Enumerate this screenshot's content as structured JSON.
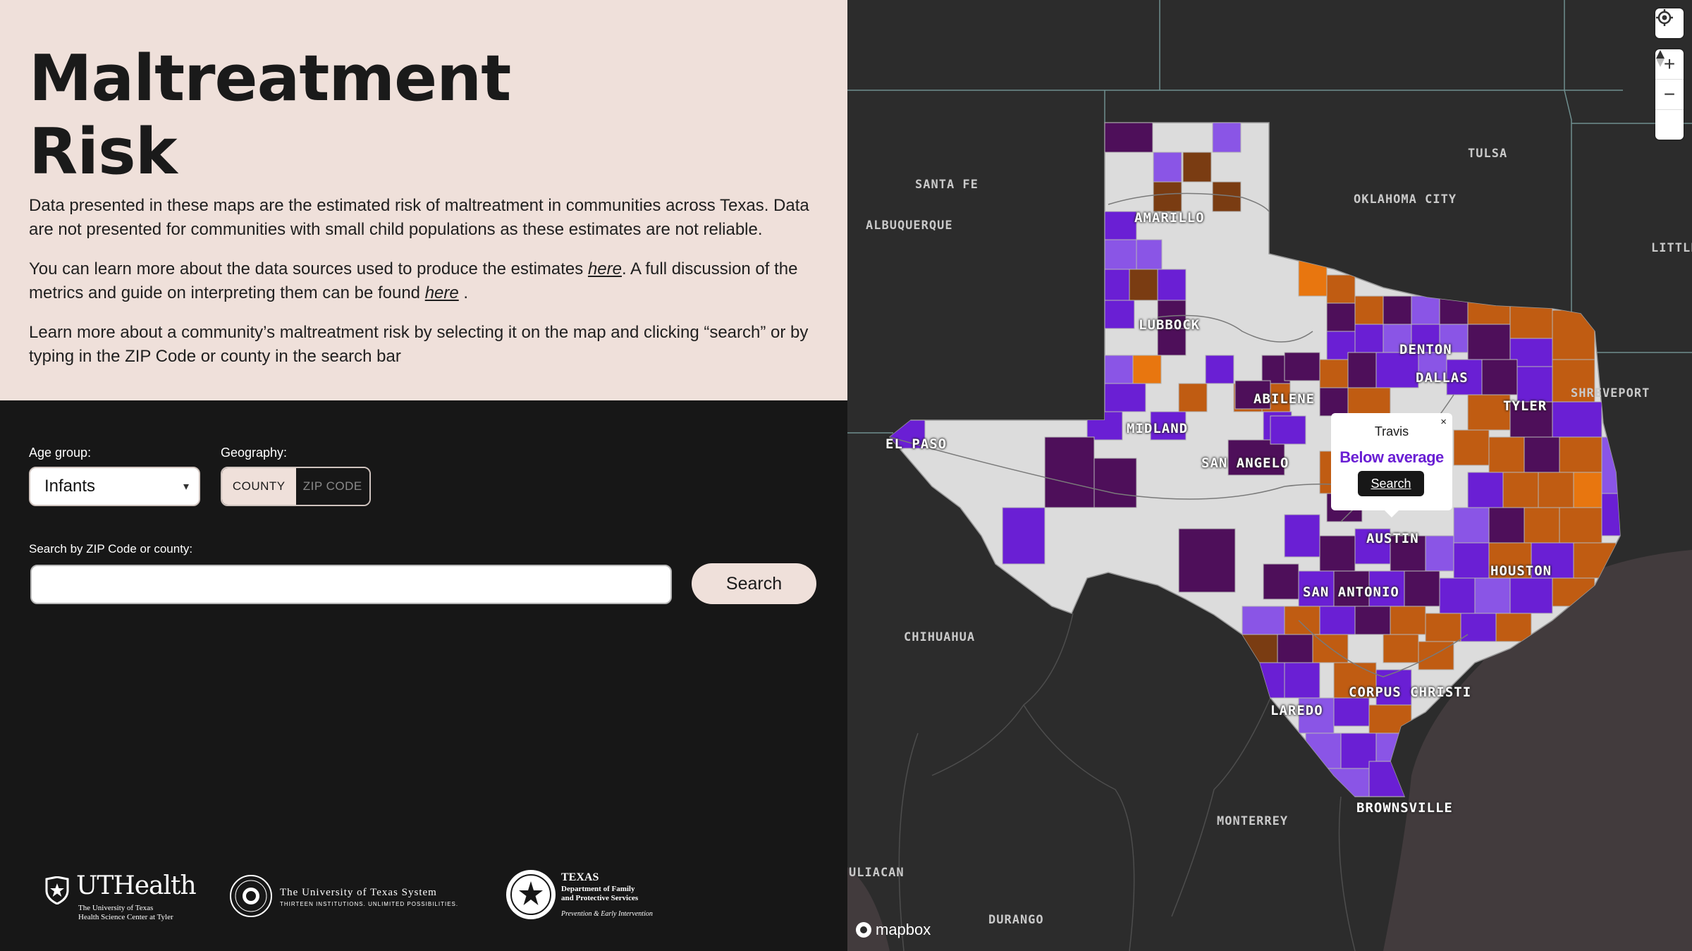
{
  "header": {
    "title_line1": "Maltreatment",
    "title_line2": "Risk"
  },
  "intro": {
    "p1": "Data presented in these maps are the estimated risk of maltreatment in communities across Texas. Data are not presented for communities with small child populations as these estimates are not reliable.",
    "p2_before": "You can learn more about the data sources used to produce the estimates ",
    "p2_link1": "here",
    "p2_middle": ". A full discussion of the metrics and guide on interpreting them can be found ",
    "p2_link2": "here",
    "p2_after": " .",
    "p3": "Learn more about a community’s maltreatment risk by selecting it on the map and clicking “search” or by typing in the ZIP Code or county in the search bar"
  },
  "controls": {
    "age_label": "Age group:",
    "age_value": "Infants",
    "geo_label": "Geography:",
    "geo_options": [
      "COUNTY",
      "ZIP CODE"
    ],
    "geo_selected": "COUNTY",
    "search_label": "Search by ZIP Code or county:",
    "search_value": "",
    "search_button": "Search"
  },
  "logos": {
    "uthealth_name": "UTHealth",
    "uthealth_sub1": "The University of Texas",
    "uthealth_sub2": "Health Science Center at Tyler",
    "uts_name": "The University of Texas System",
    "uts_sub": "THIRTEEN INSTITUTIONS. UNLIMITED POSSIBILITIES.",
    "dfps_name": "TEXAS",
    "dfps_sub1": "Department of Family",
    "dfps_sub2": "and Protective Services",
    "dfps_sub3": "Prevention & Early Intervention"
  },
  "map": {
    "cities_texas": [
      "AMARILLO",
      "LUBBOCK",
      "DENTON",
      "DALLAS",
      "ABILENE",
      "TYLER",
      "MIDLAND",
      "EL PASO",
      "SAN ANGELO",
      "AUSTIN",
      "HOUSTON",
      "SAN ANTONIO",
      "CORPUS CHRISTI",
      "LAREDO",
      "BROWNSVILLE"
    ],
    "cities_outside": [
      "SANTA FE",
      "ALBUQUERQUE",
      "TULSA",
      "OKLAHOMA CITY",
      "LITTLE",
      "SHREVEPORT",
      "CHIHUAHUA",
      "MONTERREY",
      "DURANGO",
      "ULIACAN"
    ],
    "colors": {
      "background": "#2c2c2c",
      "no_data": "#dcdcdc",
      "well_below": "#8a55e6",
      "below": "#6a1fd4",
      "low_dark": "#4e0f5a",
      "above": "#c05c12",
      "well_above": "#e8760f",
      "brown": "#7a3c12"
    },
    "popup": {
      "county": "Travis",
      "risk": "Below average",
      "button": "Search",
      "close": "×"
    },
    "attribution": "mapbox",
    "controls": [
      "locate-icon",
      "zoom-in-icon",
      "zoom-out-icon",
      "compass-icon"
    ]
  }
}
